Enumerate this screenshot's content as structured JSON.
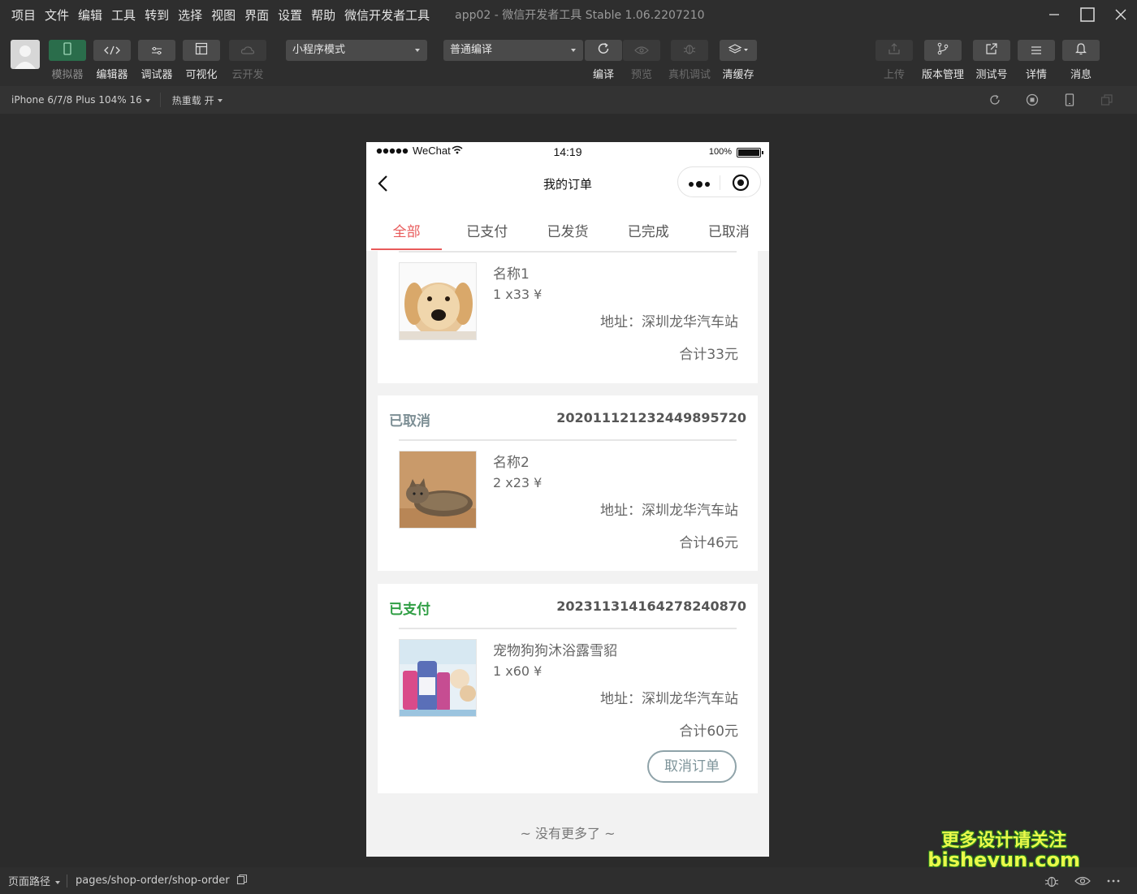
{
  "menubar": {
    "items": [
      "项目",
      "文件",
      "编辑",
      "工具",
      "转到",
      "选择",
      "视图",
      "界面",
      "设置",
      "帮助",
      "微信开发者工具"
    ],
    "window_title": "app02 - 微信开发者工具 Stable 1.06.2207210"
  },
  "toolbar": {
    "left_tools": [
      {
        "label": "模拟器",
        "icon": "phone-icon",
        "state": "active"
      },
      {
        "label": "编辑器",
        "icon": "code-icon",
        "state": "normal"
      },
      {
        "label": "调试器",
        "icon": "sliders-icon",
        "state": "normal"
      },
      {
        "label": "可视化",
        "icon": "layout-icon",
        "state": "normal"
      },
      {
        "label": "云开发",
        "icon": "cloud-icon",
        "state": "disabled"
      }
    ],
    "mode_select": "小程序模式",
    "compile_select": "普通编译",
    "mid_tools": [
      {
        "label": "编译",
        "icon": "refresh-icon",
        "state": "normal"
      },
      {
        "label": "预览",
        "icon": "eye-icon",
        "state": "disabled"
      },
      {
        "label": "真机调试",
        "icon": "bug-icon",
        "state": "disabled"
      },
      {
        "label": "清缓存",
        "icon": "layers-icon",
        "state": "normal"
      }
    ],
    "right_tools": [
      {
        "label": "上传",
        "icon": "upload-icon",
        "state": "disabled"
      },
      {
        "label": "版本管理",
        "icon": "branch-icon",
        "state": "normal"
      },
      {
        "label": "测试号",
        "icon": "external-link-icon",
        "state": "normal"
      },
      {
        "label": "详情",
        "icon": "menu-icon",
        "state": "normal"
      },
      {
        "label": "消息",
        "icon": "bell-icon",
        "state": "normal"
      }
    ]
  },
  "devbar": {
    "device": "iPhone 6/7/8 Plus 104% 16",
    "hot_reload": "热重载 开"
  },
  "phone": {
    "status": {
      "carrier": "WeChat",
      "time": "14:19",
      "battery": "100%"
    },
    "nav_title": "我的订单",
    "tabs": [
      "全部",
      "已支付",
      "已发货",
      "已完成",
      "已取消"
    ],
    "active_tab": 0,
    "orders": [
      {
        "status": "",
        "order_no": "",
        "name": "名称1",
        "qty": "1 x33 ¥",
        "address": "地址：深圳龙华汽车站",
        "total": "合计33元",
        "image": "dog"
      },
      {
        "status": "已取消",
        "status_color": "#7d8f95",
        "order_no": "20201112123244989572​0",
        "name": "名称2",
        "qty": "2 x23 ¥",
        "address": "地址：深圳龙华汽车站",
        "total": "合计46元",
        "image": "cat"
      },
      {
        "status": "已支付",
        "status_color": "#2f9e44",
        "order_no": "20231131416427824087​0",
        "name": "宠物狗狗沐浴露雪貂",
        "qty": "1 x60 ¥",
        "address": "地址：深圳龙华汽车站",
        "total": "合计60元",
        "image": "shampoo",
        "cancel_label": "取消订单"
      }
    ],
    "no_more": "~ 没有更多了 ~"
  },
  "bottombar": {
    "path_label": "页面路径",
    "path": "pages/shop-order/shop-order"
  },
  "watermark": {
    "line1": "更多设计请关注",
    "line2": "bisheyun.com"
  },
  "colors": {
    "accent": "#e85a5a",
    "active_tool": "#2a6d4b",
    "bg": "#2b2b2b"
  }
}
